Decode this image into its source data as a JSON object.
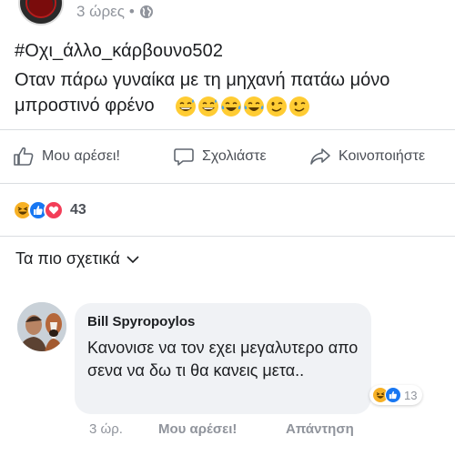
{
  "post": {
    "time": "3 ώρες",
    "dot": "•",
    "hashtag": "#Οχι_άλλο_κάρβουνο502",
    "text": "Οταν πάρω γυναίκα με τη μηχανή πατάω μόνο μπροστινό φρένο",
    "emojis": [
      "grin-sweat-icon",
      "grin-sweat-icon",
      "tears-of-joy-icon",
      "tears-of-joy-icon",
      "wink-icon",
      "wink-icon"
    ]
  },
  "actions": {
    "like": "Μου αρέσει!",
    "comment": "Σχολιάστε",
    "share": "Κοινοποιήστε"
  },
  "reactions": {
    "icons": [
      "haha-icon",
      "like-icon",
      "love-icon"
    ],
    "count": "43"
  },
  "filter": {
    "label": "Τα πιο σχετικά"
  },
  "comment": {
    "author": "Bill Spyropoylos",
    "text": "Κανονισε να τον εχει μεγαλυτερο απο σενα να δω τι θα κανεις μετα..",
    "reaction_count": "13",
    "time": "3 ώρ.",
    "like": "Μου αρέσει!",
    "reply": "Απάντηση"
  },
  "colors": {
    "like_blue": "#1877f2",
    "love_red": "#f33e58",
    "haha_yellow": "#f7b125",
    "muted": "#90949c"
  }
}
